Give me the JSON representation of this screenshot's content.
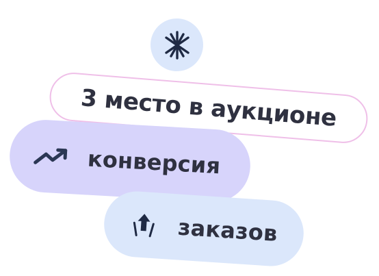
{
  "top_icon": {
    "name": "asterisk-sparkle-icon",
    "background_color": "#dbe7fb",
    "icon_color": "#1f2a44"
  },
  "badges": [
    {
      "text": "3 место в аукционе",
      "background_color": "#ffffff",
      "border_color": "#efbfe8",
      "text_color": "#2f3140"
    },
    {
      "text": "конверсия",
      "icon": "trending-up-icon",
      "background_color": "#d7d4fb",
      "text_color": "#2f3140"
    },
    {
      "text": "заказов",
      "icon": "up-arrow-icon",
      "background_color": "#dbe7fb",
      "text_color": "#2f3140"
    }
  ]
}
